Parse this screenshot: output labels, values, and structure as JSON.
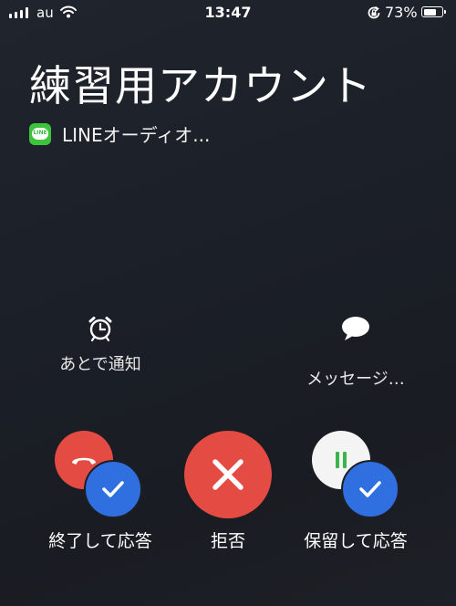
{
  "status_bar": {
    "carrier": "au",
    "time": "13:47",
    "battery_percent": "73%",
    "battery_level": 0.73,
    "icons": [
      "signal-icon",
      "wifi-icon",
      "rotation-lock-icon",
      "battery-icon"
    ]
  },
  "call": {
    "caller_name": "練習用アカウント",
    "app_label": "LINEオーディオ...",
    "app_icon": "line-app-icon",
    "app_icon_text": "LINE"
  },
  "options": {
    "remind_label": "あとで通知",
    "remind_icon": "alarm-clock-icon",
    "message_label": "メッセージ…",
    "message_icon": "speech-bubble-icon"
  },
  "actions": {
    "end_and_accept_label": "終了して応答",
    "decline_label": "拒否",
    "hold_and_accept_label": "保留して応答"
  },
  "colors": {
    "background": "#1c1f26",
    "red": "#e34b43",
    "blue": "#2f6fe0",
    "green": "#3ec33c",
    "hold_green": "#39b54a"
  }
}
